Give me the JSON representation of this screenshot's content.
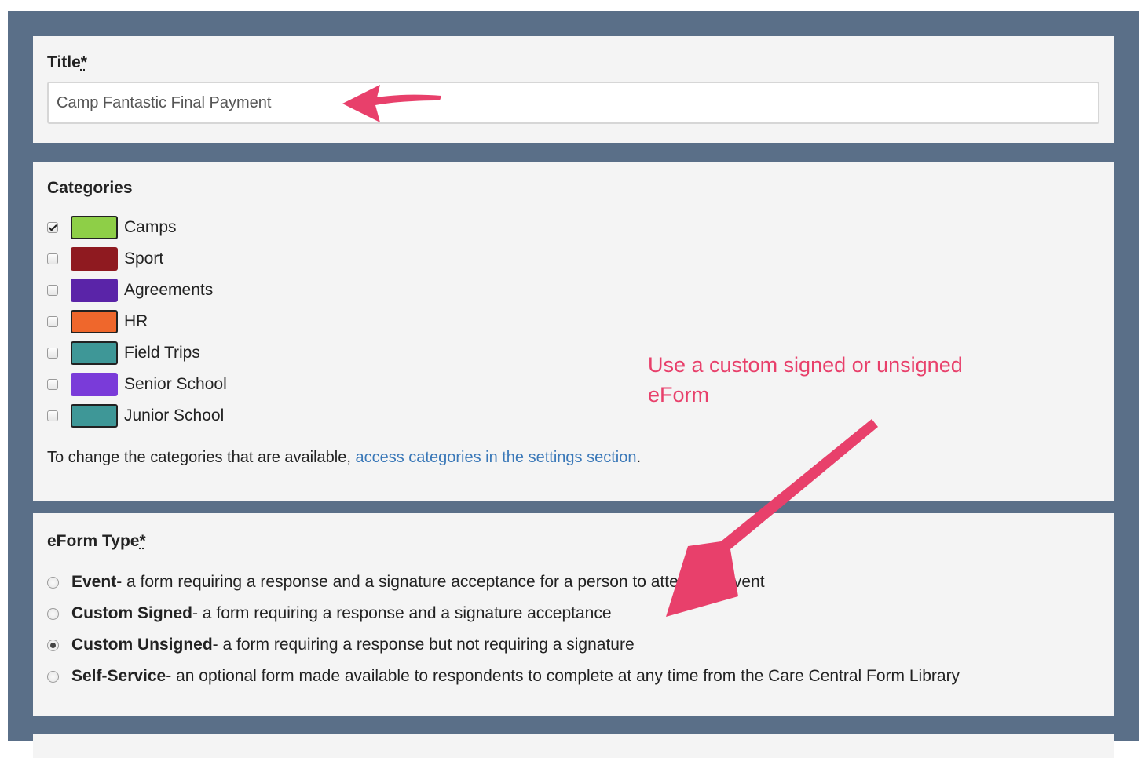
{
  "title_section": {
    "label": "Title",
    "required_mark": "*",
    "value": "Camp Fantastic Final Payment"
  },
  "categories_section": {
    "label": "Categories",
    "items": [
      {
        "name": "Camps",
        "color": "#8ecf47",
        "checked": true
      },
      {
        "name": "Sport",
        "color": "#8f1a20",
        "checked": false
      },
      {
        "name": "Agreements",
        "color": "#5a24a8",
        "checked": false
      },
      {
        "name": "HR",
        "color": "#ef672c",
        "checked": false
      },
      {
        "name": "Field Trips",
        "color": "#3e9797",
        "checked": false
      },
      {
        "name": "Senior School",
        "color": "#7a3bd9",
        "checked": false
      },
      {
        "name": "Junior School",
        "color": "#3e9797",
        "checked": false
      }
    ],
    "note_prefix": "To change the categories that are available, ",
    "note_link": "access categories in the settings section",
    "note_suffix": "."
  },
  "eform_type_section": {
    "label": "eForm Type",
    "required_mark": "*",
    "options": [
      {
        "name": "Event",
        "desc": " - a form requiring a response and a signature acceptance for a person to attend an event",
        "selected": false
      },
      {
        "name": "Custom Signed",
        "desc": " - a form requiring a response and a signature acceptance",
        "selected": false
      },
      {
        "name": "Custom Unsigned",
        "desc": " - a form requiring a response but not requiring a signature",
        "selected": true
      },
      {
        "name": "Self-Service",
        "desc": " - an optional form made available to respondents to complete at any time from the Care Central Form Library",
        "selected": false
      }
    ]
  },
  "annotation": {
    "text": "Use a custom signed or unsigned eForm",
    "color": "#e8406b"
  }
}
